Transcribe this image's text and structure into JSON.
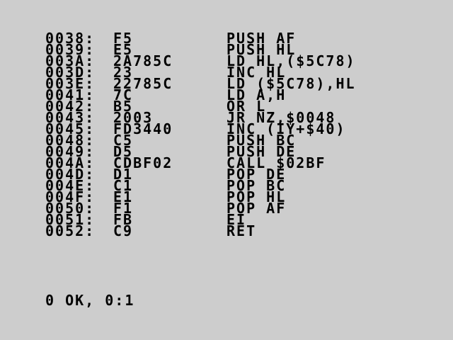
{
  "colors": {
    "background": "#cdcdcd",
    "text": "#000000"
  },
  "listing": [
    {
      "address": "0038:",
      "bytes": "F5",
      "instruction": "PUSH AF"
    },
    {
      "address": "0039:",
      "bytes": "E5",
      "instruction": "PUSH HL"
    },
    {
      "address": "003A:",
      "bytes": "2A785C",
      "instruction": "LD HL,($5C78)"
    },
    {
      "address": "003D:",
      "bytes": "23",
      "instruction": "INC HL"
    },
    {
      "address": "003E:",
      "bytes": "22785C",
      "instruction": "LD ($5C78),HL"
    },
    {
      "address": "0041:",
      "bytes": "7C",
      "instruction": "LD A,H"
    },
    {
      "address": "0042:",
      "bytes": "B5",
      "instruction": "OR L"
    },
    {
      "address": "0043:",
      "bytes": "2003",
      "instruction": "JR NZ,$0048"
    },
    {
      "address": "0045:",
      "bytes": "FD3440",
      "instruction": "INC (IY+$40)"
    },
    {
      "address": "0048:",
      "bytes": "C5",
      "instruction": "PUSH BC"
    },
    {
      "address": "0049:",
      "bytes": "D5",
      "instruction": "PUSH DE"
    },
    {
      "address": "004A:",
      "bytes": "CDBF02",
      "instruction": "CALL $02BF"
    },
    {
      "address": "004D:",
      "bytes": "D1",
      "instruction": "POP DE"
    },
    {
      "address": "004E:",
      "bytes": "C1",
      "instruction": "POP BC"
    },
    {
      "address": "004F:",
      "bytes": "E1",
      "instruction": "POP HL"
    },
    {
      "address": "0050:",
      "bytes": "F1",
      "instruction": "POP AF"
    },
    {
      "address": "0051:",
      "bytes": "FB",
      "instruction": "EI"
    },
    {
      "address": "0052:",
      "bytes": "C9",
      "instruction": "RET"
    }
  ],
  "status_line": "0 OK, 0:1"
}
